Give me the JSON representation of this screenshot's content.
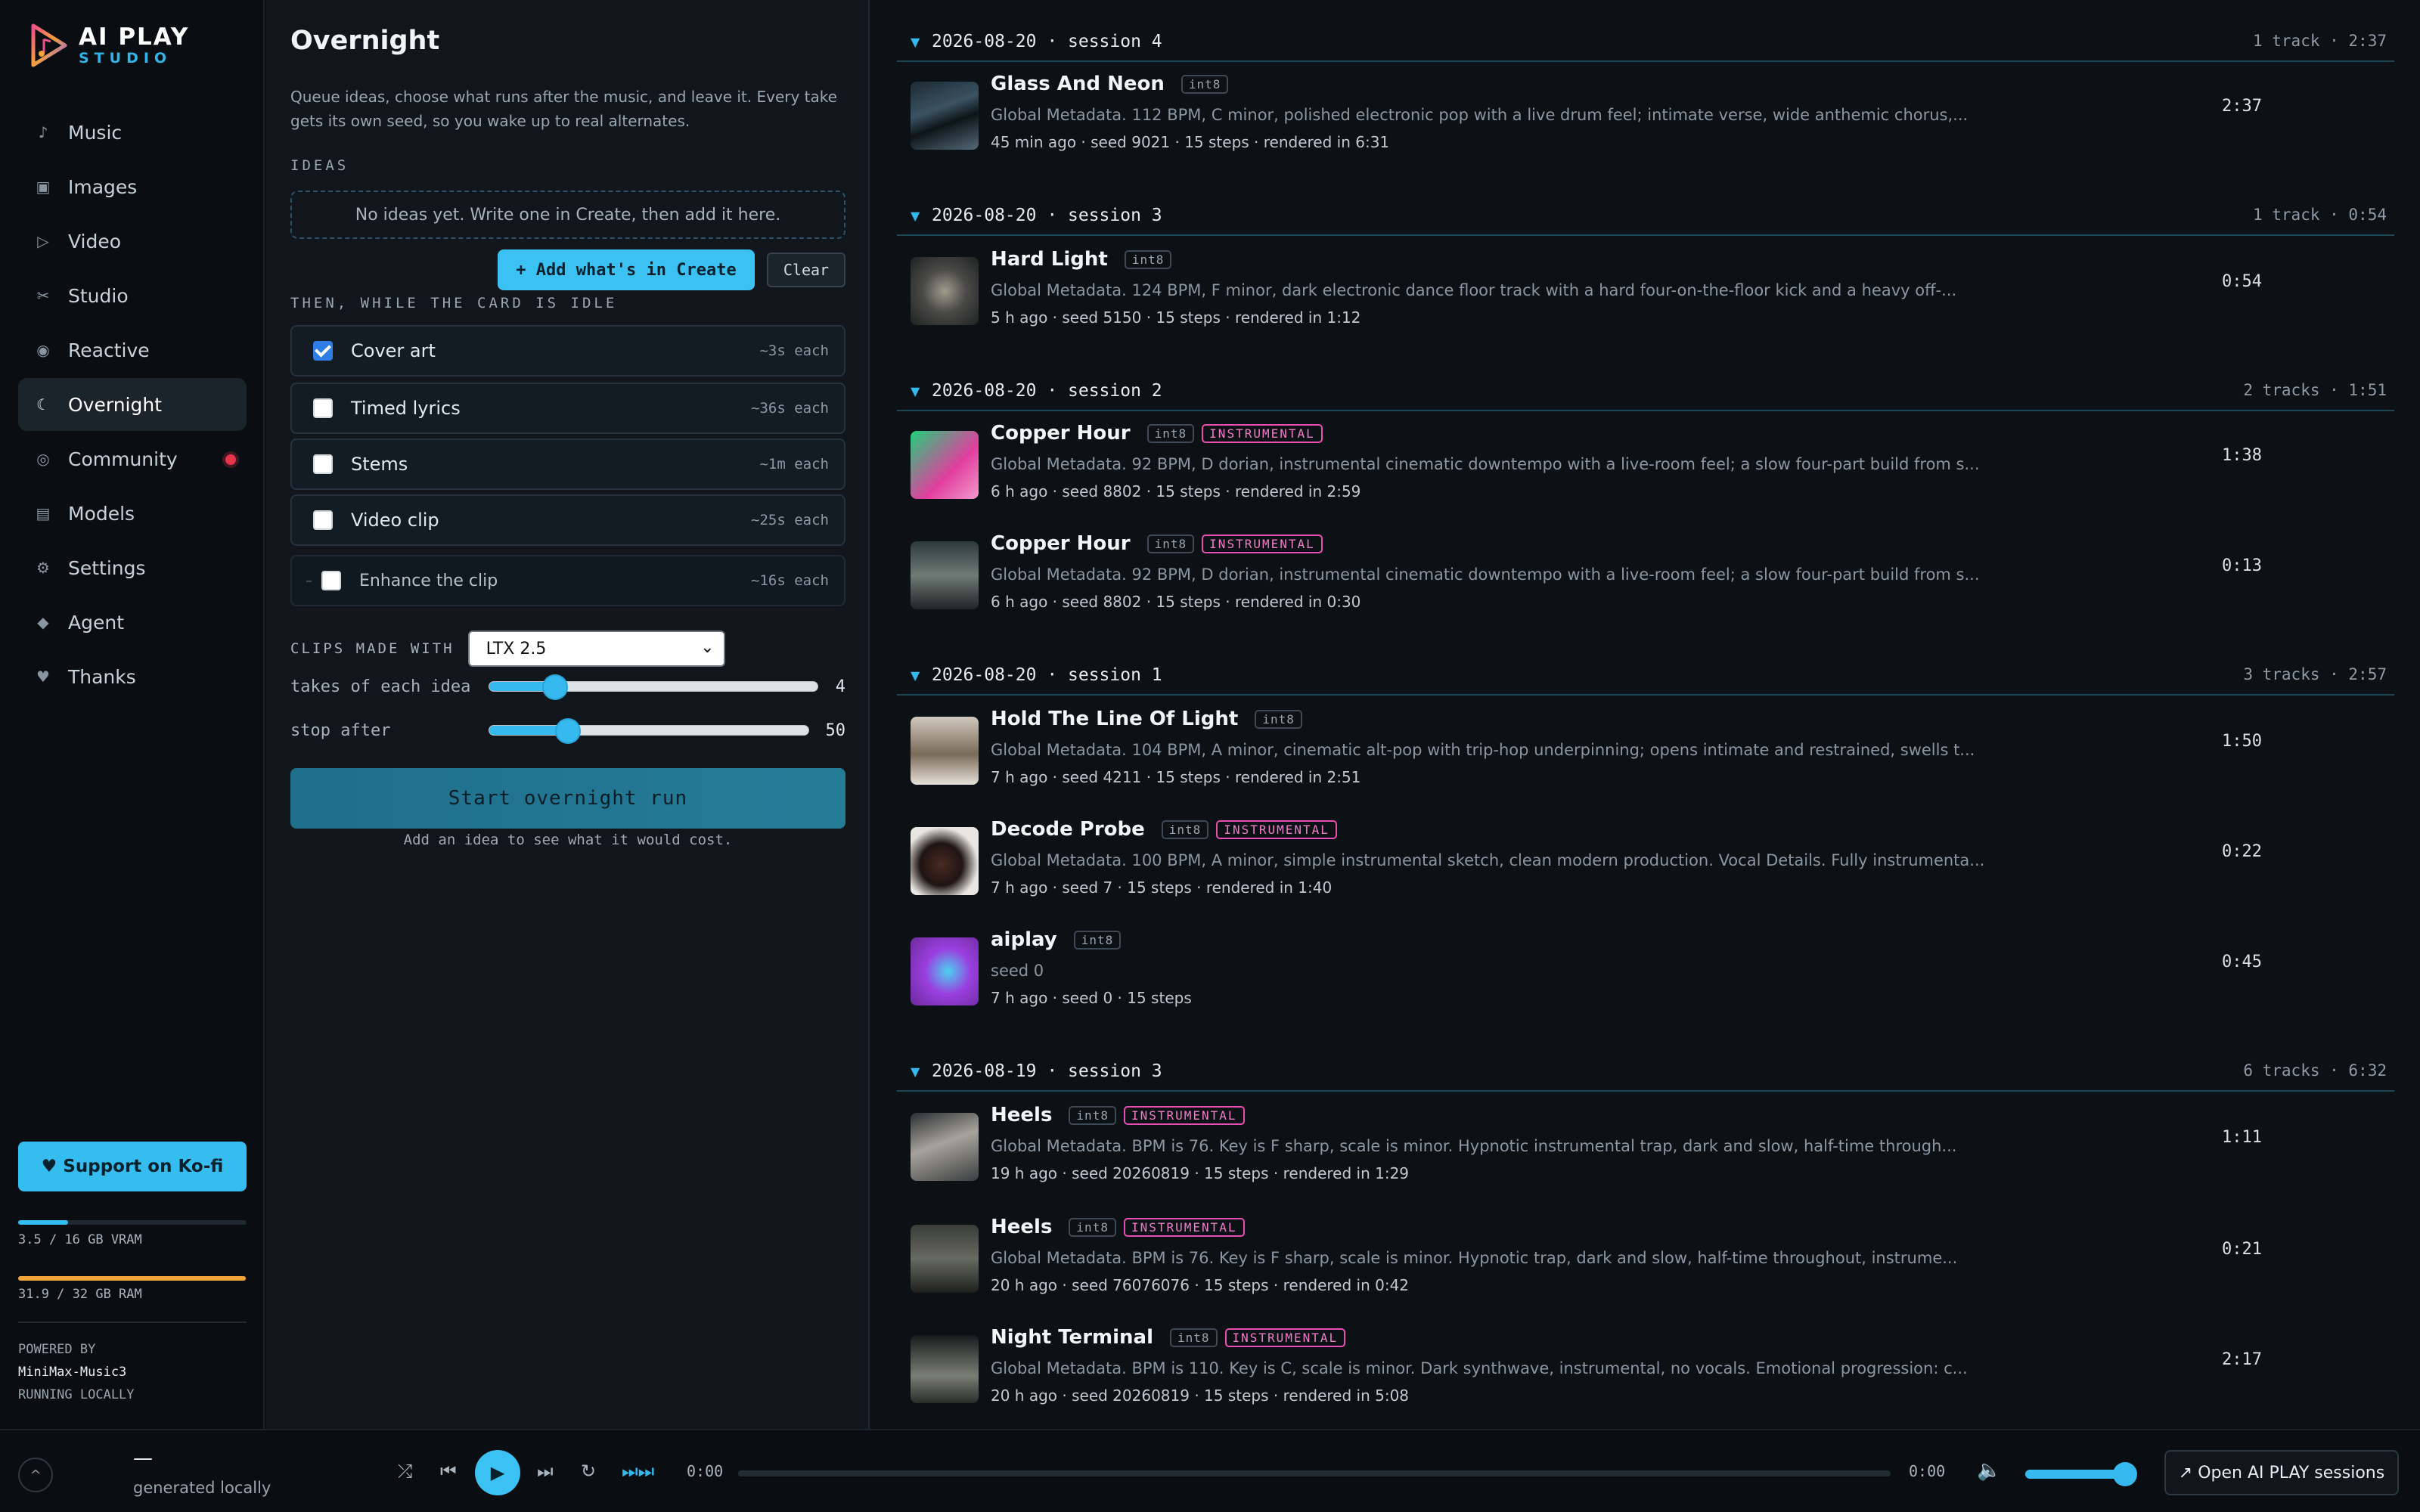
{
  "app": {
    "title_line1": "AI PLAY",
    "title_line2": "STUDIO"
  },
  "sidebar": {
    "items": [
      {
        "icon": "♪",
        "label": "Music"
      },
      {
        "icon": "▣",
        "label": "Images"
      },
      {
        "icon": "▷",
        "label": "Video"
      },
      {
        "icon": "✂",
        "label": "Studio"
      },
      {
        "icon": "◉",
        "label": "Reactive"
      },
      {
        "icon": "☾",
        "label": "Overnight"
      },
      {
        "icon": "◎",
        "label": "Community"
      },
      {
        "icon": "▤",
        "label": "Models"
      },
      {
        "icon": "⚙",
        "label": "Settings"
      },
      {
        "icon": "◆",
        "label": "Agent"
      },
      {
        "icon": "♥",
        "label": "Thanks"
      }
    ],
    "active": "Overnight",
    "kofi_label": "♥ Support on Ko-fi",
    "vram_label": "3.5 / 16 GB VRAM",
    "vram_fraction": 0.22,
    "ram_label": "31.9 / 32 GB RAM",
    "ram_fraction": 0.997,
    "powered_by": "POWERED BY",
    "model_name": "MiniMax-Music3",
    "running": "RUNNING LOCALLY",
    "colors": {
      "accent": "#35bdf0",
      "vram": "#35bdf0",
      "ram": "#f0a43a",
      "notify": "#e8344a"
    }
  },
  "overnight": {
    "title": "Overnight",
    "description": "Queue ideas, choose what runs after the music, and leave it. Every take gets its own seed, so you wake up to real alternates.",
    "ideas_label": "IDEAS",
    "ideas_empty": "No ideas yet. Write one in Create, then add it here.",
    "add_button": "+ Add what's in Create",
    "clear_button": "Clear",
    "idle_label": "THEN, WHILE THE CARD IS IDLE",
    "options": [
      {
        "label": "Cover art",
        "cost": "~3s each",
        "checked": true
      },
      {
        "label": "Timed lyrics",
        "cost": "~36s each",
        "checked": false
      },
      {
        "label": "Stems",
        "cost": "~1m each",
        "checked": false
      },
      {
        "label": "Video clip",
        "cost": "~25s each",
        "checked": false
      },
      {
        "label": "Enhance the clip",
        "cost": "~16s each",
        "checked": false
      }
    ],
    "clips_label": "CLIPS MADE WITH",
    "clips_model": "LTX 2.5",
    "takes_label": "takes of each idea",
    "takes_value": "4",
    "takes_min": 1,
    "takes_max": 16,
    "takes_num": 4,
    "stop_label": "stop after",
    "stop_value": "50",
    "stop_min": 1,
    "stop_max": 200,
    "stop_num": 50,
    "start_button": "Start overnight run",
    "cost_note": "Add an idea to see what it would cost."
  },
  "sessions": [
    {
      "name": "2026-08-20 · session 4",
      "meta": "1 track · 2:37",
      "tracks": [
        {
          "title": "Glass And Neon",
          "instrumental": false,
          "desc": "Global Metadata. 112 BPM, C minor, polished electronic pop with a live drum feel; intimate verse, wide anthemic chorus,...",
          "meta": "45 min ago · seed 9021 · 15 steps · rendered in 6:31",
          "duration": "2:37",
          "thumb": "dark-keys"
        }
      ]
    },
    {
      "name": "2026-08-20 · session 3",
      "meta": "1 track · 0:54",
      "tracks": [
        {
          "title": "Hard Light",
          "instrumental": false,
          "desc": "Global Metadata. 124 BPM, F minor, dark electronic dance floor track with a hard four-on-the-floor kick and a heavy off-...",
          "meta": "5 h ago · seed 5150 · 15 steps · rendered in 1:12",
          "duration": "0:54",
          "thumb": "shell"
        }
      ]
    },
    {
      "name": "2026-08-20 · session 2",
      "meta": "2 tracks · 1:51",
      "tracks": [
        {
          "title": "Copper Hour",
          "instrumental": true,
          "desc": "Global Metadata. 92 BPM, D dorian, instrumental cinematic downtempo with a live-room feel; a slow four-part build from s...",
          "meta": "6 h ago · seed 8802 · 15 steps · rendered in 2:59",
          "duration": "1:38",
          "thumb": "gradient-green-pink"
        },
        {
          "title": "Copper Hour",
          "instrumental": true,
          "desc": "Global Metadata. 92 BPM, D dorian, instrumental cinematic downtempo with a live-room feel; a slow four-part build from s...",
          "meta": "6 h ago · seed 8802 · 15 steps · rendered in 0:30",
          "duration": "0:13",
          "thumb": "room"
        }
      ]
    },
    {
      "name": "2026-08-20 · session 1",
      "meta": "3 tracks · 2:57",
      "tracks": [
        {
          "title": "Hold The Line Of Light",
          "instrumental": false,
          "desc": "Global Metadata. 104 BPM, A minor, cinematic alt-pop with trip-hop underpinning; opens intimate and restrained, swells t...",
          "meta": "7 h ago · seed 4211 · 15 steps · rendered in 2:51",
          "duration": "1:50",
          "thumb": "stone"
        },
        {
          "title": "Decode Probe",
          "instrumental": true,
          "desc": "Global Metadata. 100 BPM, A minor, simple instrumental sketch, clean modern production. Vocal Details. Fully instrumenta...",
          "meta": "7 h ago · seed 7 · 15 steps · rendered in 1:40",
          "duration": "0:22",
          "thumb": "leather"
        },
        {
          "title": "aiplay",
          "instrumental": false,
          "desc": "seed 0",
          "meta": "7 h ago · seed 0 · 15 steps",
          "duration": "0:45",
          "thumb": "gradient-purple"
        }
      ]
    },
    {
      "name": "2026-08-19 · session 3",
      "meta": "6 tracks · 6:32",
      "tracks": [
        {
          "title": "Heels",
          "instrumental": true,
          "desc": "Global Metadata. BPM is 76. Key is F sharp, scale is minor. Hypnotic instrumental trap, dark and slow, half-time through...",
          "meta": "19 h ago · seed 20260819 · 15 steps · rendered in 1:29",
          "duration": "1:11",
          "thumb": "heel"
        },
        {
          "title": "Heels",
          "instrumental": true,
          "desc": "Global Metadata. BPM is 76. Key is F sharp, scale is minor. Hypnotic trap, dark and slow, half-time throughout, instrume...",
          "meta": "20 h ago · seed 76076076 · 15 steps · rendered in 0:42",
          "duration": "0:21",
          "thumb": "heel-dark"
        },
        {
          "title": "Night Terminal",
          "instrumental": true,
          "desc": "Global Metadata. BPM is 110. Key is C, scale is minor. Dark synthwave, instrumental, no vocals. Emotional progression: c...",
          "meta": "20 h ago · seed 20260819 · 15 steps · rendered in 5:08",
          "duration": "2:17",
          "thumb": "rock"
        }
      ]
    }
  ],
  "badges": {
    "int8": "int8",
    "instrumental": "INSTRUMENTAL"
  },
  "player": {
    "collapse_icon": "^",
    "now_title": "—",
    "now_sub": "generated locally",
    "time_current": "0:00",
    "time_total": "0:00",
    "volume_fraction": 0.95,
    "open_button": "↗ Open AI PLAY sessions",
    "icons": [
      "shuffle-icon",
      "prev-icon",
      "play-icon",
      "next-icon",
      "repeat-icon",
      "queue-icon",
      "volume-icon"
    ]
  }
}
